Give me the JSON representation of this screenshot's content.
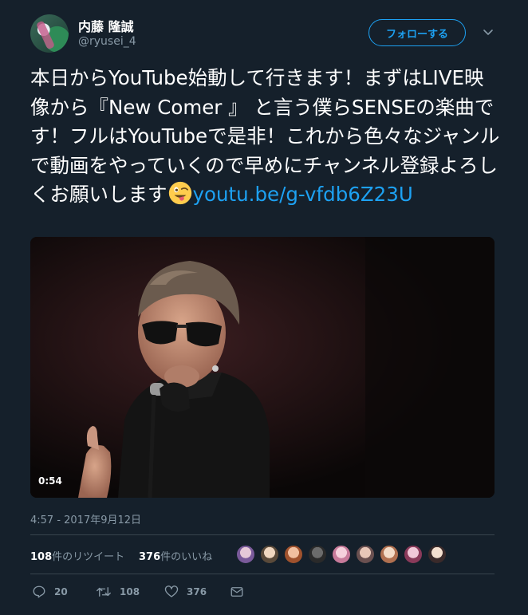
{
  "user": {
    "display_name": "内藤 隆誠",
    "handle": "@ryusei_4"
  },
  "follow_button": {
    "label": "フォローする"
  },
  "tweet": {
    "text": "本日からYouTube始動して行きます！まずはLIVE映像から『New Comer 』 と言う僕らSENSEの楽曲です！フルはYouTubeで是非！これから色々なジャンルで動画をやっていくので早めにチャンネル登録よろしくお願いします",
    "emoji": "winking-tongue-emoji",
    "link": "youtu.be/g-vfdb6Z23U"
  },
  "media": {
    "duration": "0:54"
  },
  "timestamp": "4:57 - 2017年9月12日",
  "stats": {
    "retweets_count": "108",
    "retweets_label": "件のリツイート",
    "likes_count": "376",
    "likes_label": "件のいいね"
  },
  "actions": {
    "reply_count": "20",
    "retweet_count": "108",
    "like_count": "376"
  },
  "colors": {
    "background": "#15202b",
    "accent": "#1da1f2",
    "secondary_text": "#8899a6",
    "divider": "#38444d"
  },
  "icons": [
    "chevron-down-icon",
    "reply-icon",
    "retweet-icon",
    "heart-icon",
    "mail-icon"
  ]
}
